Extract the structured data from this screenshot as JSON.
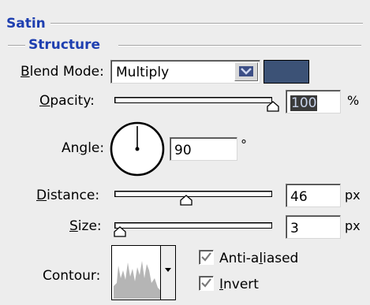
{
  "section": {
    "title": "Satin"
  },
  "structure": {
    "title": "Structure"
  },
  "blend_mode": {
    "label_prefix": "",
    "label_accel": "B",
    "label_rest": "lend Mode:",
    "value": "Multiply",
    "color": "#3c5276"
  },
  "opacity": {
    "label_accel": "O",
    "label_rest": "pacity:",
    "value": "100",
    "unit": "%",
    "level": 100
  },
  "angle": {
    "label_pre": "An",
    "label_accel": "g",
    "label_rest": "le:",
    "value": "90",
    "unit": "°"
  },
  "distance": {
    "label_accel": "D",
    "label_rest": "istance:",
    "value": "46",
    "unit": "px",
    "level": 46
  },
  "size": {
    "label_accel": "S",
    "label_rest": "ize:",
    "value": "3",
    "unit": "px",
    "level": 3
  },
  "contour": {
    "label": "Contour:",
    "anti_aliased": {
      "label_pre": "Anti-a",
      "label_accel": "l",
      "label_rest": "iased",
      "checked": true
    },
    "invert": {
      "label_accel": "I",
      "label_rest": "nvert",
      "checked": true
    }
  }
}
